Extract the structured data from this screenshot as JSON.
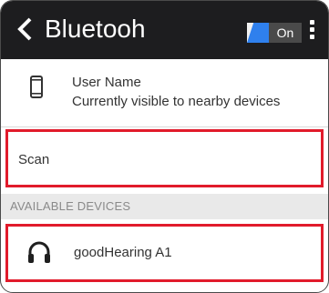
{
  "header": {
    "title": "Bluetooh",
    "back_icon": "chevron-left-icon",
    "menu_icon": "more-vert-icon",
    "bluetooth_toggle": {
      "label": "On",
      "state": "on",
      "accent_color": "#2f80ed"
    }
  },
  "this_device": {
    "icon": "phone-icon",
    "name": "User Name",
    "status": "Currently visible to nearby devices"
  },
  "scan": {
    "label": "Scan"
  },
  "available_section": {
    "header": "AVAILABLE DEVICES",
    "devices": [
      {
        "icon": "headphones-icon",
        "name": "goodHearing A1"
      }
    ]
  },
  "highlight_color": "#e11b2b"
}
